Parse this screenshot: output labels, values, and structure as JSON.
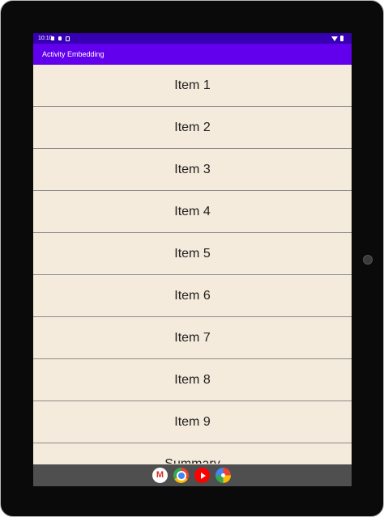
{
  "status_bar": {
    "time": "10:10"
  },
  "app_bar": {
    "title": "Activity Embedding"
  },
  "list": {
    "items": [
      {
        "label": "Item 1"
      },
      {
        "label": "Item 2"
      },
      {
        "label": "Item 3"
      },
      {
        "label": "Item 4"
      },
      {
        "label": "Item 5"
      },
      {
        "label": "Item 6"
      },
      {
        "label": "Item 7"
      },
      {
        "label": "Item 8"
      },
      {
        "label": "Item 9"
      },
      {
        "label": "Summary"
      }
    ]
  },
  "dock": {
    "apps": [
      "gmail-icon",
      "chrome-icon",
      "youtube-icon",
      "photos-icon"
    ]
  },
  "colors": {
    "status_bar": "#3700b3",
    "app_bar": "#6200ee",
    "list_background": "#f5ebdc",
    "nav_bar": "#4f4f4f"
  }
}
